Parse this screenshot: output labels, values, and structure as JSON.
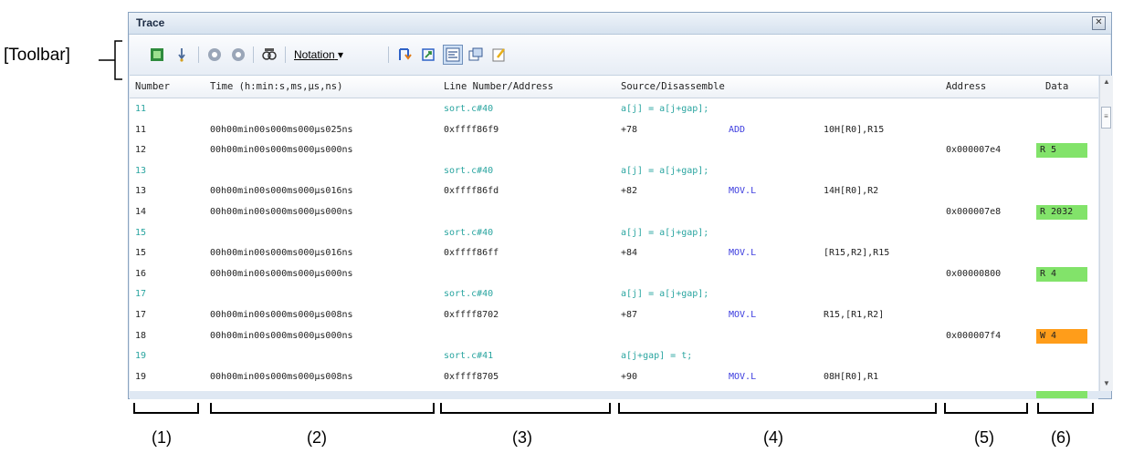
{
  "callout": {
    "toolbar_label": "[Toolbar]"
  },
  "window": {
    "title": "Trace",
    "close_glyph": "✕"
  },
  "toolbar": {
    "notation_label": "Notation",
    "notation_arrow": "▾",
    "icons": [
      "acquire-trace-icon",
      "step-in-icon",
      "link-prev-icon",
      "link-next-icon",
      "find-icon",
      "notation-icon",
      "jump-source-icon",
      "jump-disassemble-icon",
      "mixed-display-icon",
      "window-undock-icon",
      "save-icon"
    ]
  },
  "grid": {
    "columns": [
      "Number",
      "Time (h:min:s,ms,µs,ns)",
      "Line Number/Address",
      "Source/Disassemble",
      "Address",
      "Data"
    ],
    "rows": [
      {
        "num": "11",
        "time": "",
        "line": "sort.c#40",
        "src1": "a[j] = a[j+gap];",
        "src2": "",
        "src3": "",
        "addr": "",
        "data": "",
        "kind": "source"
      },
      {
        "num": "11",
        "time": "00h00min00s000ms000µs025ns",
        "line": "0xffff86f9",
        "src1": "+78",
        "src2": "ADD",
        "src3": "10H[R0],R15",
        "addr": "",
        "data": "",
        "kind": "asm"
      },
      {
        "num": "12",
        "time": "00h00min00s000ms000µs000ns",
        "line": "",
        "src1": "",
        "src2": "",
        "src3": "",
        "addr": "0x000007e4",
        "data": "R 5",
        "kind": "mem",
        "color": "#82e36a"
      },
      {
        "num": "13",
        "time": "",
        "line": "sort.c#40",
        "src1": "a[j] = a[j+gap];",
        "src2": "",
        "src3": "",
        "addr": "",
        "data": "",
        "kind": "source"
      },
      {
        "num": "13",
        "time": "00h00min00s000ms000µs016ns",
        "line": "0xffff86fd",
        "src1": "+82",
        "src2": "MOV.L",
        "src3": "14H[R0],R2",
        "addr": "",
        "data": "",
        "kind": "asm"
      },
      {
        "num": "14",
        "time": "00h00min00s000ms000µs000ns",
        "line": "",
        "src1": "",
        "src2": "",
        "src3": "",
        "addr": "0x000007e8",
        "data": "R 2032",
        "kind": "mem",
        "color": "#82e36a"
      },
      {
        "num": "15",
        "time": "",
        "line": "sort.c#40",
        "src1": "a[j] = a[j+gap];",
        "src2": "",
        "src3": "",
        "addr": "",
        "data": "",
        "kind": "source"
      },
      {
        "num": "15",
        "time": "00h00min00s000ms000µs016ns",
        "line": "0xffff86ff",
        "src1": "+84",
        "src2": "MOV.L",
        "src3": "[R15,R2],R15",
        "addr": "",
        "data": "",
        "kind": "asm"
      },
      {
        "num": "16",
        "time": "00h00min00s000ms000µs000ns",
        "line": "",
        "src1": "",
        "src2": "",
        "src3": "",
        "addr": "0x00000800",
        "data": "R 4",
        "kind": "mem",
        "color": "#82e36a"
      },
      {
        "num": "17",
        "time": "",
        "line": "sort.c#40",
        "src1": "a[j] = a[j+gap];",
        "src2": "",
        "src3": "",
        "addr": "",
        "data": "",
        "kind": "source"
      },
      {
        "num": "17",
        "time": "00h00min00s000ms000µs008ns",
        "line": "0xffff8702",
        "src1": "+87",
        "src2": "MOV.L",
        "src3": "R15,[R1,R2]",
        "addr": "",
        "data": "",
        "kind": "asm"
      },
      {
        "num": "18",
        "time": "00h00min00s000ms000µs000ns",
        "line": "",
        "src1": "",
        "src2": "",
        "src3": "",
        "addr": "0x000007f4",
        "data": "W 4",
        "kind": "mem",
        "color": "#ff9d1a"
      },
      {
        "num": "19",
        "time": "",
        "line": "sort.c#41",
        "src1": "a[j+gap] = t;",
        "src2": "",
        "src3": "",
        "addr": "",
        "data": "",
        "kind": "source"
      },
      {
        "num": "19",
        "time": "00h00min00s000ms000µs008ns",
        "line": "0xffff8705",
        "src1": "+90",
        "src2": "MOV.L",
        "src3": "08H[R0],R1",
        "addr": "",
        "data": "",
        "kind": "asm"
      }
    ]
  },
  "brackets": [
    "(1)",
    "(2)",
    "(3)",
    "(4)",
    "(5)",
    "(6)"
  ]
}
